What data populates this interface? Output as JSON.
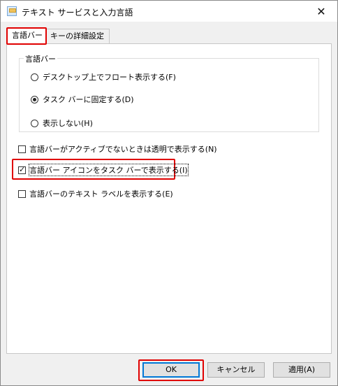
{
  "window": {
    "title": "テキスト サービスと入力言語",
    "close_glyph": "✕"
  },
  "tabs": [
    {
      "label": "言語バー",
      "active": true
    },
    {
      "label": "キーの詳細設定",
      "active": false
    }
  ],
  "group": {
    "legend": "言語バー",
    "options": [
      {
        "label": "デスクトップ上でフロート表示する(F)",
        "checked": false
      },
      {
        "label": "タスク バーに固定する(D)",
        "checked": true
      },
      {
        "label": "表示しない(H)",
        "checked": false
      }
    ]
  },
  "checkboxes": [
    {
      "label": "言語バーがアクティブでないときは透明で表示する(N)",
      "checked": false
    },
    {
      "label": "言語バー アイコンをタスク バーで表示する(I)",
      "checked": true
    },
    {
      "label": "言語バーのテキスト ラベルを表示する(E)",
      "checked": false
    }
  ],
  "buttons": {
    "ok": "OK",
    "cancel": "キャンセル",
    "apply": "適用(A)"
  },
  "colors": {
    "highlight": "#e00000",
    "focus_blue": "#0078d7"
  }
}
